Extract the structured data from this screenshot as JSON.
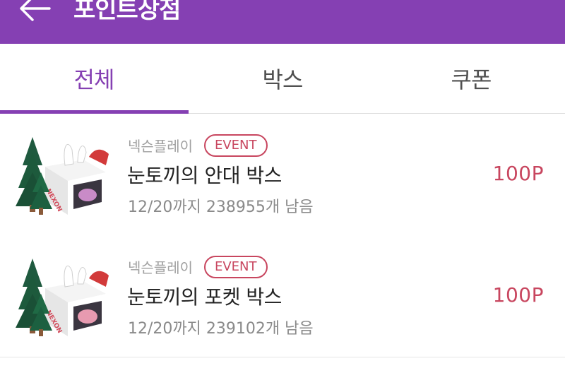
{
  "header": {
    "title": "포인트상점",
    "back_icon": "arrow-left-icon",
    "background_color": "#8540b3"
  },
  "tabs": [
    {
      "label": "전체",
      "active": true
    },
    {
      "label": "박스",
      "active": false
    },
    {
      "label": "쿠폰",
      "active": false
    }
  ],
  "items": [
    {
      "publisher": "넥슨플레이",
      "badge": "EVENT",
      "title": "눈토끼의 안대 박스",
      "subtitle": "12/20까지 238955개 남음",
      "price": "100P",
      "icon": "nexon-rabbit-box-icon"
    },
    {
      "publisher": "넥슨플레이",
      "badge": "EVENT",
      "title": "눈토끼의 포켓 박스",
      "subtitle": "12/20까지 239102개 남음",
      "price": "100P",
      "icon": "nexon-rabbit-box-icon"
    }
  ],
  "colors": {
    "accent": "#8540b3",
    "price": "#c8465f",
    "badge": "#c8465f"
  }
}
